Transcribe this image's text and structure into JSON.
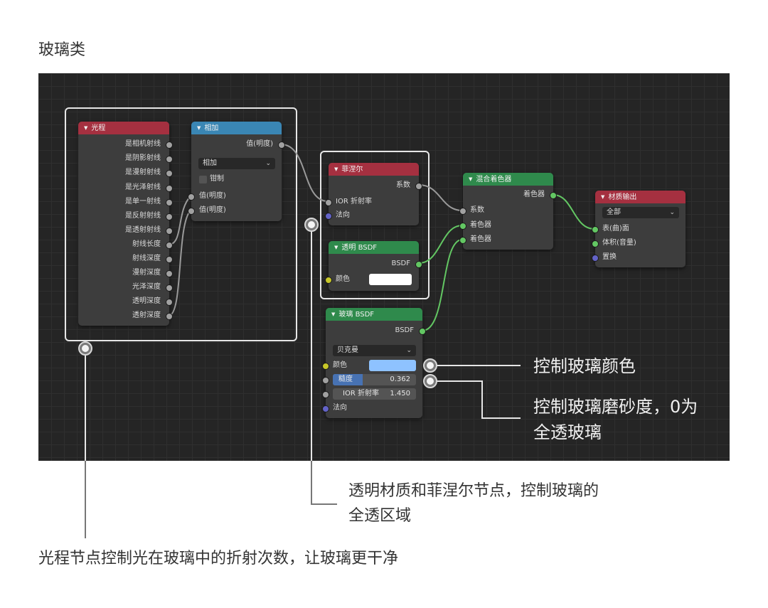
{
  "page": {
    "title": "玻璃类"
  },
  "nodes": {
    "light_path": {
      "title": "光程",
      "outputs": [
        "是相机射线",
        "是阴影射线",
        "是漫射射线",
        "是光泽射线",
        "是单一射线",
        "是反射射线",
        "是透射射线",
        "射线长度",
        "射线深度",
        "漫射深度",
        "光泽深度",
        "透明深度",
        "透射深度"
      ]
    },
    "math_add": {
      "title": "相加",
      "output": "值(明度)",
      "operation": "相加",
      "clamp_label": "钳制",
      "inputs": [
        "值(明度)",
        "值(明度)"
      ]
    },
    "fresnel": {
      "title": "菲涅尔",
      "output": "系数",
      "inputs": [
        "IOR 折射率",
        "法向"
      ]
    },
    "transparent_bsdf": {
      "title": "透明 BSDF",
      "output": "BSDF",
      "input": "颜色",
      "swatch_color": "#ffffff"
    },
    "glass_bsdf": {
      "title": "玻璃 BSDF",
      "output": "BSDF",
      "distribution": "贝克曼",
      "color_label": "颜色",
      "swatch_color": "#8ec2ff",
      "roughness_label": "糙度",
      "roughness_value": "0.362",
      "roughness_fraction": 0.362,
      "ior_label": "IOR 折射率",
      "ior_value": "1.450",
      "normal_label": "法向"
    },
    "mix_shader": {
      "title": "混合着色器",
      "output": "着色器",
      "inputs": [
        "系数",
        "着色器",
        "着色器"
      ]
    },
    "material_output": {
      "title": "材质输出",
      "target": "全部",
      "inputs": [
        "表(曲)面",
        "体积(音量)",
        "置换"
      ]
    }
  },
  "annotations": {
    "glass_color": "控制玻璃颜色",
    "glass_roughness": [
      "控制玻璃磨砂度，0为",
      "全透玻璃"
    ],
    "fresnel_note": [
      "透明材质和菲涅尔节点，控制玻璃的",
      "全透区域"
    ],
    "light_path_note": "光程节点控制光在玻璃中的折射次数，让玻璃更干净"
  },
  "colors": {
    "header_red": "#a53040",
    "header_blue": "#3a86b4",
    "header_green": "#2f8a4c",
    "socket_gray": "#a1a1a1",
    "socket_green": "#63c763",
    "socket_blue": "#6363c7",
    "socket_yellow": "#c7c729",
    "roughness_fill": "#4772b3"
  }
}
